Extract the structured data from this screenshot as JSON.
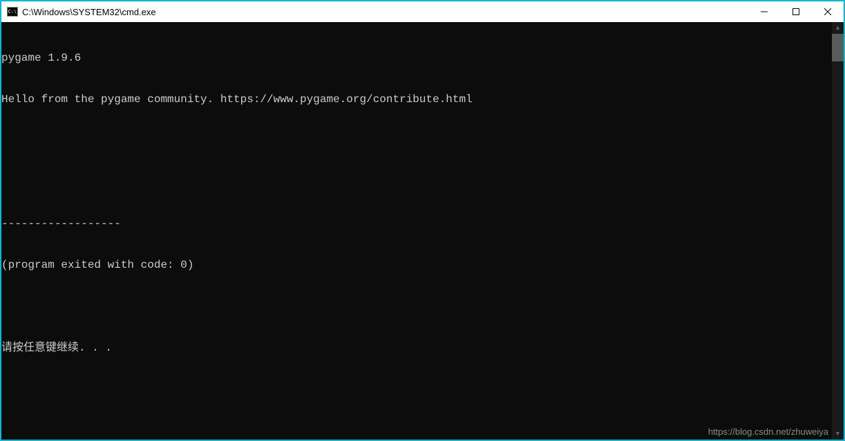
{
  "window": {
    "title": "C:\\Windows\\SYSTEM32\\cmd.exe"
  },
  "console": {
    "lines": [
      "pygame 1.9.6",
      "Hello from the pygame community. https://www.pygame.org/contribute.html",
      "",
      "",
      "------------------",
      "(program exited with code: 0)",
      "",
      "请按任意键继续. . ."
    ]
  },
  "watermark": "https://blog.csdn.net/zhuweiya"
}
